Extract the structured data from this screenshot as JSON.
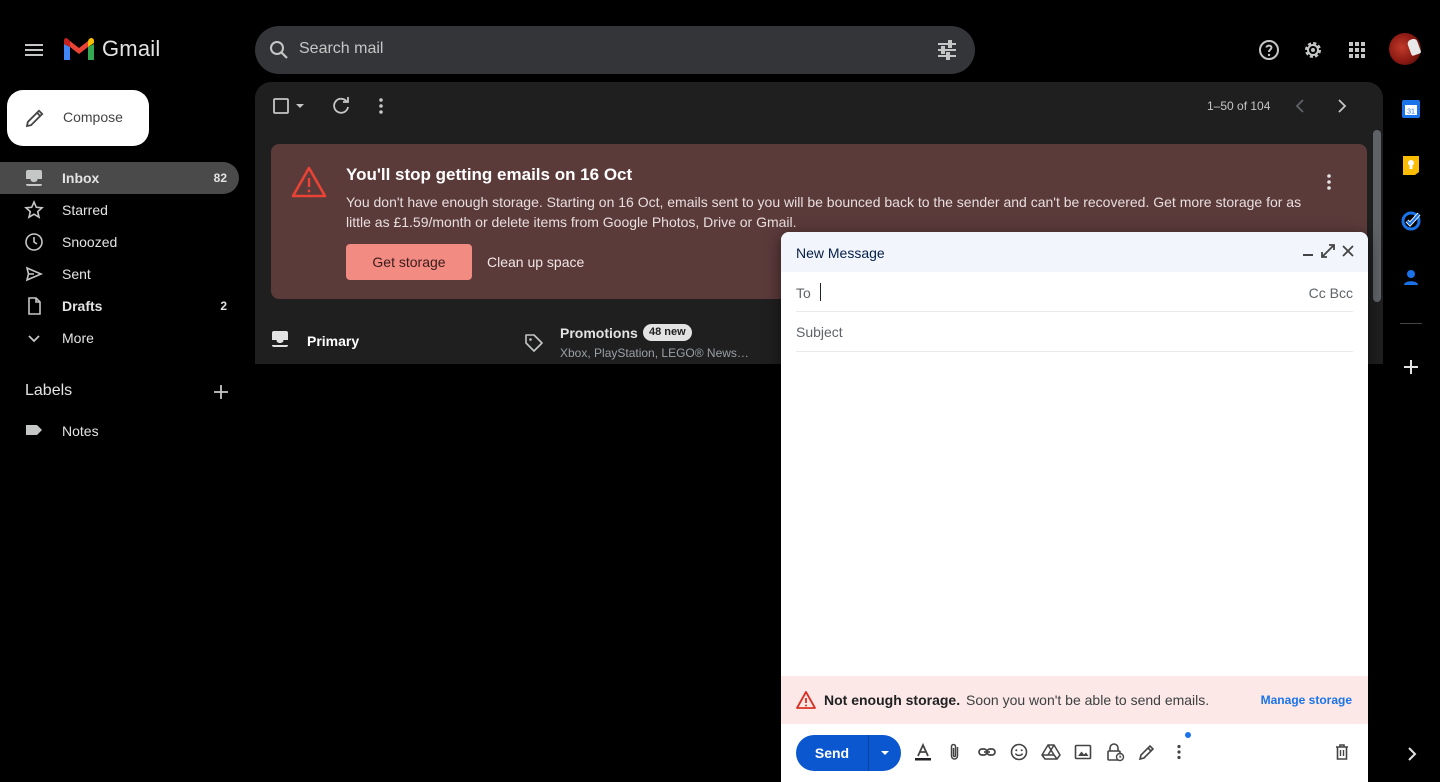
{
  "app": {
    "name": "Gmail"
  },
  "search": {
    "placeholder": "Search mail"
  },
  "compose_button": {
    "label": "Compose"
  },
  "nav": [
    {
      "label": "Inbox",
      "count": "82",
      "icon": "inbox-icon",
      "active": true
    },
    {
      "label": "Starred",
      "count": "",
      "icon": "star-icon"
    },
    {
      "label": "Snoozed",
      "count": "",
      "icon": "clock-icon"
    },
    {
      "label": "Sent",
      "count": "",
      "icon": "send-icon"
    },
    {
      "label": "Drafts",
      "count": "2",
      "icon": "draft-icon"
    },
    {
      "label": "More",
      "count": "",
      "icon": "chevron-down-icon"
    }
  ],
  "labels": {
    "heading": "Labels",
    "items": [
      {
        "label": "Notes"
      }
    ]
  },
  "toolbar": {
    "pager": "1–50 of 104"
  },
  "banner": {
    "title": "You'll stop getting emails on 16 Oct",
    "body": "You don't have enough storage. Starting on 16 Oct, emails sent to you will be bounced back to the sender and can't be recovered. Get more storage for as little as £1.59/month or delete items from Google Photos, Drive or Gmail.",
    "primary_action": "Get storage",
    "secondary_action": "Clean up space"
  },
  "tabs": {
    "primary": {
      "label": "Primary"
    },
    "promotions": {
      "label": "Promotions",
      "badge": "48 new",
      "subtitle": "Xbox, PlayStation, LEGO® News,..."
    }
  },
  "compose_window": {
    "title": "New Message",
    "to_label": "To",
    "to_value": "",
    "cc_bcc": "Cc Bcc",
    "subject_placeholder": "Subject",
    "warning_bold": "Not enough storage.",
    "warning_text": "Soon you won't be able to send emails.",
    "warning_link": "Manage storage",
    "send_label": "Send"
  },
  "colors": {
    "banner_bg": "#5b3a3a",
    "accent_blue": "#0b57d0",
    "warning_red": "#d93025",
    "get_storage_bg": "#f28b82"
  }
}
